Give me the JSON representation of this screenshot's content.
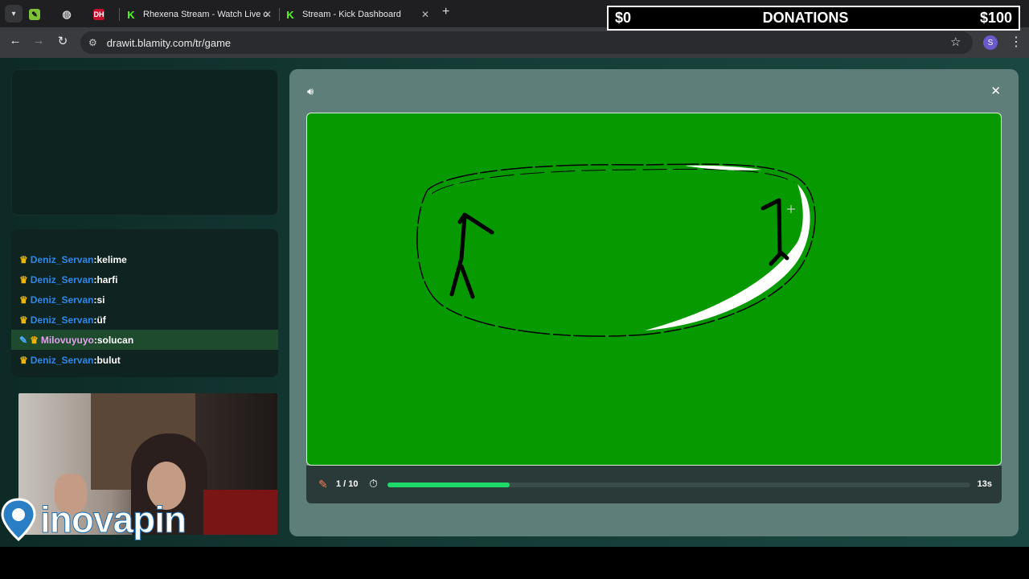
{
  "browser": {
    "tabs": [
      {
        "label": "",
        "favicon": "paint-app-icon"
      },
      {
        "label": "",
        "favicon": "globe-icon"
      },
      {
        "label": "",
        "favicon": "dh-icon",
        "favicon_text": "DH"
      },
      {
        "label": "Rhexena Stream - Watch Live o",
        "favicon": "kick-icon",
        "favicon_text": "K"
      },
      {
        "label": "Stream - Kick Dashboard",
        "favicon": "kick-icon",
        "favicon_text": "K"
      }
    ],
    "url": "drawit.blamity.com/tr/game",
    "profile_initial": "S"
  },
  "donations": {
    "left_amount": "$0",
    "title": "DONATIONS",
    "right_amount": "$100"
  },
  "chat": {
    "messages": [
      {
        "user": "Deniz_Servan",
        "text": "kelime",
        "badges": [
          "crown"
        ]
      },
      {
        "user": "Deniz_Servan",
        "text": "harfi",
        "badges": [
          "crown"
        ]
      },
      {
        "user": "Deniz_Servan",
        "text": "si",
        "badges": [
          "crown"
        ]
      },
      {
        "user": "Deniz_Servan",
        "text": "üf",
        "badges": [
          "crown"
        ]
      },
      {
        "user": "Milovuyuyo",
        "text": "solucan",
        "badges": [
          "pen",
          "crown"
        ],
        "highlight": true
      },
      {
        "user": "Deniz_Servan",
        "text": "bulut",
        "badges": [
          "crown"
        ]
      }
    ]
  },
  "overlay": {
    "logo_text": "inovapin"
  },
  "game": {
    "round": "1 / 10",
    "timer": "13s",
    "timer_progress": 0.21,
    "canvas_color": "#079a00",
    "accent": "#1fd86a"
  }
}
